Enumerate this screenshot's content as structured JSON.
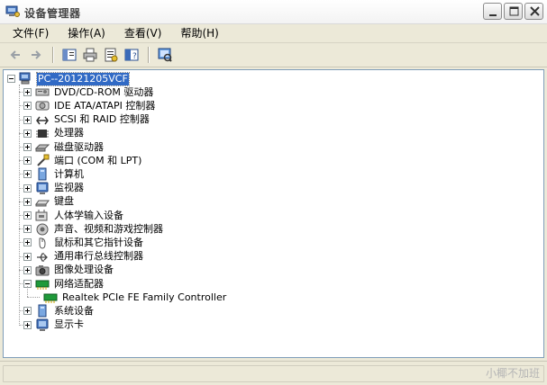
{
  "window": {
    "title": "设备管理器"
  },
  "menu": [
    "文件(F)",
    "操作(A)",
    "查看(V)",
    "帮助(H)"
  ],
  "toolbar": {
    "buttons": [
      "back-icon",
      "forward-icon",
      "show-hide-tree-icon",
      "print-icon",
      "properties-icon",
      "help-icon",
      "scan-hardware-icon"
    ]
  },
  "tree": {
    "root": "PC--20121205VCF",
    "categories": [
      {
        "label": "DVD/CD-ROM 驱动器",
        "icon": "dvd-drive-icon",
        "expanded": false
      },
      {
        "label": "IDE ATA/ATAPI 控制器",
        "icon": "ide-controller-icon",
        "expanded": false
      },
      {
        "label": "SCSI 和 RAID 控制器",
        "icon": "scsi-controller-icon",
        "expanded": false
      },
      {
        "label": "处理器",
        "icon": "processor-icon",
        "expanded": false
      },
      {
        "label": "磁盘驱动器",
        "icon": "disk-drive-icon",
        "expanded": false
      },
      {
        "label": "端口 (COM 和 LPT)",
        "icon": "port-icon",
        "expanded": false
      },
      {
        "label": "计算机",
        "icon": "computer-icon",
        "expanded": false
      },
      {
        "label": "监视器",
        "icon": "monitor-icon",
        "expanded": false
      },
      {
        "label": "键盘",
        "icon": "keyboard-icon",
        "expanded": false
      },
      {
        "label": "人体学输入设备",
        "icon": "hid-icon",
        "expanded": false
      },
      {
        "label": "声音、视频和游戏控制器",
        "icon": "sound-icon",
        "expanded": false
      },
      {
        "label": "鼠标和其它指针设备",
        "icon": "mouse-icon",
        "expanded": false
      },
      {
        "label": "通用串行总线控制器",
        "icon": "usb-icon",
        "expanded": false
      },
      {
        "label": "图像处理设备",
        "icon": "imaging-icon",
        "expanded": false
      },
      {
        "label": "网络适配器",
        "icon": "network-adapter-icon",
        "expanded": true,
        "children": [
          {
            "label": "Realtek PCIe FE Family Controller",
            "icon": "network-card-icon"
          }
        ]
      },
      {
        "label": "系统设备",
        "icon": "system-device-icon",
        "expanded": false
      },
      {
        "label": "显示卡",
        "icon": "display-adapter-icon",
        "expanded": false
      }
    ]
  },
  "watermark": "小椰不加班",
  "colors": {
    "selection": "#316ac5",
    "window_bg": "#ece9d8",
    "tree_border": "#7f9db9"
  }
}
